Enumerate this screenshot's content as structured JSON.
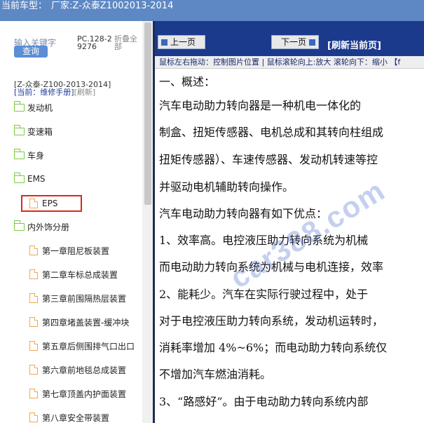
{
  "topbar": {
    "label": "当前车型：",
    "value": "厂家:Z-众泰Z1002013-2014"
  },
  "left": {
    "keyword_placeholder": "输入关键字",
    "query_label": "查询",
    "pc_code": "PC.128-29276",
    "collapse_label": "折叠全部",
    "model_tag": "[Z-众泰-Z100-2013-2014]",
    "crumb_current": "[当前：维修手册]",
    "crumb_refresh": "[刷新]",
    "tree": [
      {
        "label": "发动机",
        "type": "folder"
      },
      {
        "label": "变速箱",
        "type": "folder"
      },
      {
        "label": "车身",
        "type": "folder"
      },
      {
        "label": "EMS",
        "type": "folder"
      },
      {
        "label": "EPS",
        "type": "doc",
        "highlight": true
      },
      {
        "label": "内外饰分册",
        "type": "folder"
      },
      {
        "label": "第一章阻尼板装置",
        "type": "doc"
      },
      {
        "label": "第二章车标总成装置",
        "type": "doc"
      },
      {
        "label": "第三章前围隔热层装置",
        "type": "doc"
      },
      {
        "label": "第四章堵盖装置-缓冲块",
        "type": "doc"
      },
      {
        "label": "第五章后侧围排气口出口",
        "type": "doc"
      },
      {
        "label": "第六章前地毯总成装置",
        "type": "doc"
      },
      {
        "label": "第七章顶盖内护面装置",
        "type": "doc"
      },
      {
        "label": "第八章安全带装置",
        "type": "doc"
      }
    ]
  },
  "nav": {
    "prev_label": "上一页",
    "next_label": "下一页",
    "refresh_label": "[刷新当前页]",
    "hint": "鼠标左右拖动：控制图片位置 | 鼠标滚轮向上:放大  滚轮向下：缩小 【f"
  },
  "content": {
    "lines": [
      "一、概述：",
      "    汽车电动助力转向器是一种机电一体化的",
      "制盒、扭矩传感器、电机总成和其转向柱组成",
      "扭矩传感器）、车速传感器、发动机转速等控",
      "并驱动电机辅助转向操作。",
      "    汽车电动助力转向器有如下优点：",
      "    1、效率高。电控液压助力转向系统为机械",
      "而电动助力转向系统为机械与电机连接，效率",
      "    2、能耗少。汽车在实际行驶过程中，处于",
      "对于电控液压助力转向系统，发动机运转时，",
      "消耗率增加 4%~6%；而电动助力转向系统仅",
      "不增加汽车燃油消耗。",
      "    3、“路感好”。由于电动助力转向系统内部"
    ]
  },
  "watermark": "car388.com",
  "colors": {
    "topbar": "#5e88c4",
    "navbar": "#1b3a8c",
    "highlight_box": "#d9291c",
    "folder": "#7ac943",
    "doc": "#f0a84e"
  }
}
